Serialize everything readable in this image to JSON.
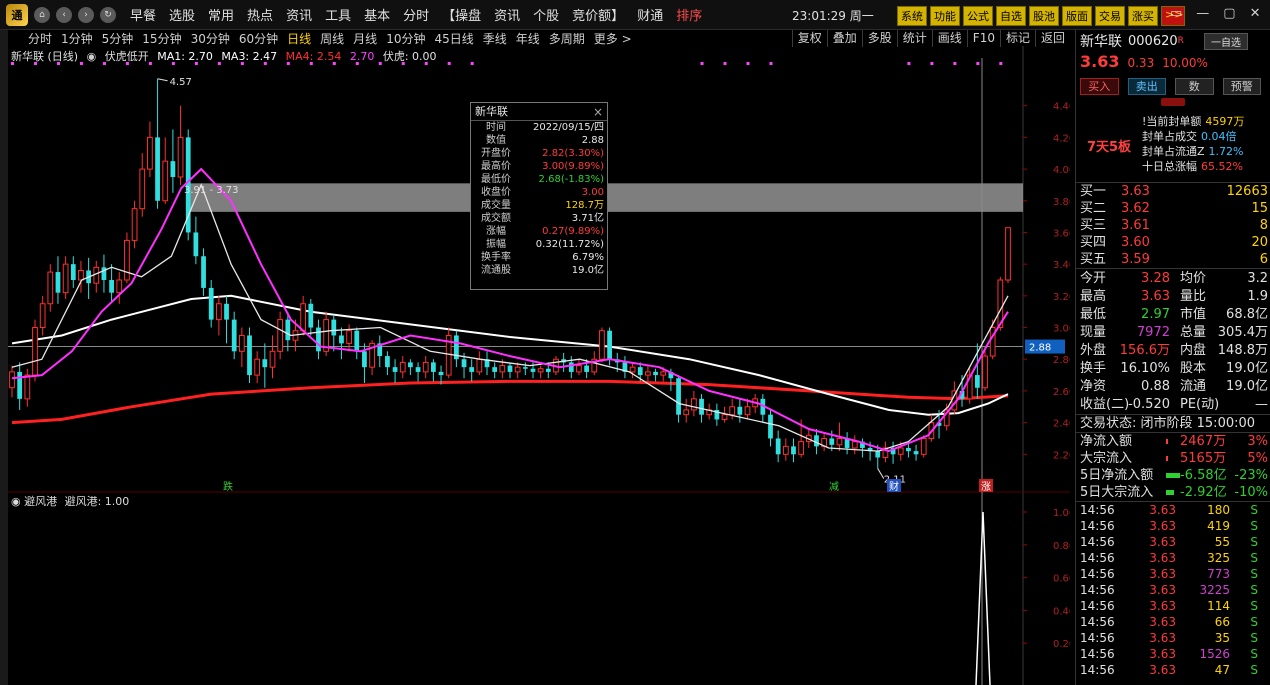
{
  "topbar": {
    "logo": "通",
    "menu": [
      "早餐",
      "选股",
      "常用",
      "热点",
      "资讯",
      "工具",
      "基本",
      "分时",
      "【操盘",
      "资讯",
      "个股",
      "竞价额】",
      "财通",
      "排序"
    ],
    "clock": "23:01:29 周一",
    "tools": [
      "系统",
      "功能",
      "公式",
      "自选",
      "股池",
      "版面",
      "交易",
      "涨买"
    ],
    "double_arrow": ">>",
    "window_controls": [
      "▭",
      "—",
      "▢",
      "✕"
    ]
  },
  "periods": [
    "分时",
    "1分钟",
    "5分钟",
    "15分钟",
    "30分钟",
    "60分钟",
    "日线",
    "周线",
    "月线",
    "10分钟",
    "45日线",
    "季线",
    "年线",
    "多周期",
    "更多 >"
  ],
  "active_period": "日线",
  "right_buttons": [
    "复权",
    "叠加",
    "多股",
    "统计",
    "画线",
    "F10",
    "标记",
    "返回"
  ],
  "legend": {
    "title": "新华联 (日线)",
    "check": "伏虎低开",
    "ma1": "MA1: 2.70",
    "ma3": "MA3: 2.47",
    "ma4": "MA4: 2.54",
    "v270": "2.70",
    "fuhu": "伏虎: 0.00"
  },
  "chart_labels": {
    "high": "4.57",
    "range": "3.91 - 3.73",
    "low": "2.11",
    "crosshair": "2.88",
    "markers": [
      "跌",
      "减",
      "财",
      "涨"
    ]
  },
  "sub_chart": {
    "check": "避风港",
    "value": "避风港: 1.00"
  },
  "chart_data": {
    "type": "candlestick",
    "price_axis": [
      "4.40",
      "4.20",
      "4.00",
      "3.80",
      "3.60",
      "3.40",
      "3.20",
      "3.00",
      "2.80",
      "2.60",
      "2.40",
      "2.20"
    ],
    "sub_axis": [
      "1.00",
      "0.80",
      "0.60",
      "0.40",
      "0.20"
    ],
    "ylim": [
      2.0,
      4.6
    ],
    "crosshair_price": 2.88,
    "shaded_zone": [
      3.73,
      3.91
    ],
    "highest": 4.57,
    "lowest": 2.11,
    "candles": [
      [
        2.62,
        2.72,
        2.56,
        2.76
      ],
      [
        2.72,
        2.55,
        2.48,
        2.78
      ],
      [
        2.55,
        2.7,
        2.5,
        2.74
      ],
      [
        2.7,
        3.0,
        2.66,
        3.05
      ],
      [
        3.0,
        3.15,
        2.95,
        3.2
      ],
      [
        3.15,
        3.35,
        3.1,
        3.4
      ],
      [
        3.35,
        3.22,
        3.15,
        3.45
      ],
      [
        3.22,
        3.4,
        3.18,
        3.45
      ],
      [
        3.4,
        3.3,
        3.25,
        3.45
      ],
      [
        3.3,
        3.36,
        3.22,
        3.42
      ],
      [
        3.36,
        3.28,
        3.18,
        3.44
      ],
      [
        3.28,
        3.38,
        3.22,
        3.42
      ],
      [
        3.38,
        3.3,
        3.22,
        3.46
      ],
      [
        3.3,
        3.22,
        3.16,
        3.4
      ],
      [
        3.22,
        3.3,
        3.15,
        3.35
      ],
      [
        3.3,
        3.55,
        3.28,
        3.6
      ],
      [
        3.55,
        3.75,
        3.5,
        3.8
      ],
      [
        3.75,
        4.0,
        3.7,
        4.1
      ],
      [
        4.0,
        4.2,
        3.95,
        4.3
      ],
      [
        4.2,
        3.8,
        3.75,
        4.57
      ],
      [
        3.8,
        4.05,
        3.78,
        4.2
      ],
      [
        4.05,
        3.95,
        3.85,
        4.25
      ],
      [
        3.95,
        4.2,
        3.9,
        4.4
      ],
      [
        4.2,
        3.6,
        3.55,
        4.25
      ],
      [
        3.6,
        3.45,
        3.4,
        3.7
      ],
      [
        3.45,
        3.25,
        3.2,
        3.5
      ],
      [
        3.25,
        3.05,
        3.0,
        3.3
      ],
      [
        3.05,
        3.15,
        2.95,
        3.2
      ],
      [
        3.15,
        3.05,
        2.9,
        3.2
      ],
      [
        3.05,
        2.85,
        2.8,
        3.1
      ],
      [
        2.85,
        2.95,
        2.75,
        3.0
      ],
      [
        2.95,
        2.7,
        2.65,
        3.0
      ],
      [
        2.7,
        2.8,
        2.65,
        2.85
      ],
      [
        2.8,
        2.75,
        2.62,
        2.9
      ],
      [
        2.75,
        2.85,
        2.68,
        2.95
      ],
      [
        2.85,
        3.05,
        2.8,
        3.1
      ],
      [
        3.05,
        2.92,
        2.85,
        3.1
      ],
      [
        2.92,
        2.98,
        2.85,
        3.05
      ],
      [
        2.98,
        3.15,
        2.95,
        3.2
      ],
      [
        3.15,
        3.0,
        2.95,
        3.18
      ],
      [
        3.0,
        2.85,
        2.8,
        3.05
      ],
      [
        2.85,
        3.05,
        2.82,
        3.1
      ],
      [
        3.05,
        2.95,
        2.85,
        3.08
      ],
      [
        2.95,
        2.9,
        2.8,
        3.0
      ],
      [
        2.9,
        2.98,
        2.85,
        3.02
      ],
      [
        2.98,
        2.85,
        2.8,
        3.0
      ],
      [
        2.85,
        2.75,
        2.65,
        2.9
      ],
      [
        2.75,
        2.9,
        2.7,
        2.92
      ],
      [
        2.9,
        2.82,
        2.75,
        2.95
      ],
      [
        2.82,
        2.75,
        2.7,
        2.85
      ],
      [
        2.75,
        2.72,
        2.65,
        2.8
      ],
      [
        2.72,
        2.78,
        2.68,
        2.82
      ],
      [
        2.78,
        2.75,
        2.7,
        2.8
      ],
      [
        2.75,
        2.72,
        2.66,
        2.78
      ],
      [
        2.72,
        2.78,
        2.68,
        2.82
      ],
      [
        2.78,
        2.72,
        2.66,
        2.8
      ],
      [
        2.72,
        2.7,
        2.64,
        2.76
      ],
      [
        2.7,
        2.95,
        2.68,
        3.0
      ],
      [
        2.95,
        2.8,
        2.75,
        2.98
      ],
      [
        2.8,
        2.75,
        2.68,
        2.84
      ],
      [
        2.75,
        2.72,
        2.66,
        2.8
      ],
      [
        2.72,
        2.8,
        2.7,
        2.85
      ],
      [
        2.8,
        2.75,
        2.7,
        2.85
      ],
      [
        2.75,
        2.72,
        2.68,
        2.78
      ],
      [
        2.72,
        2.76,
        2.68,
        2.8
      ],
      [
        2.76,
        2.72,
        2.68,
        2.78
      ],
      [
        2.72,
        2.75,
        2.68,
        2.78
      ],
      [
        2.75,
        2.74,
        2.7,
        2.78
      ],
      [
        2.74,
        2.72,
        2.68,
        2.78
      ],
      [
        2.72,
        2.74,
        2.68,
        2.76
      ],
      [
        2.74,
        2.72,
        2.68,
        2.78
      ],
      [
        2.72,
        2.8,
        2.7,
        2.82
      ],
      [
        2.8,
        2.78,
        2.72,
        2.84
      ],
      [
        2.78,
        2.72,
        2.68,
        2.82
      ],
      [
        2.72,
        2.76,
        2.7,
        2.8
      ],
      [
        2.76,
        2.72,
        2.68,
        2.8
      ],
      [
        2.72,
        2.8,
        2.7,
        2.85
      ],
      [
        2.8,
        2.98,
        2.78,
        3.0
      ],
      [
        2.98,
        2.8,
        2.76,
        3.0
      ],
      [
        2.8,
        2.78,
        2.72,
        2.84
      ],
      [
        2.78,
        2.72,
        2.68,
        2.82
      ],
      [
        2.72,
        2.75,
        2.68,
        2.78
      ],
      [
        2.75,
        2.7,
        2.66,
        2.78
      ],
      [
        2.7,
        2.72,
        2.66,
        2.76
      ],
      [
        2.72,
        2.7,
        2.66,
        2.74
      ],
      [
        2.7,
        2.72,
        2.66,
        2.75
      ],
      [
        2.72,
        2.68,
        2.6,
        2.74
      ],
      [
        2.68,
        2.45,
        2.4,
        2.7
      ],
      [
        2.45,
        2.48,
        2.4,
        2.55
      ],
      [
        2.48,
        2.55,
        2.44,
        2.6
      ],
      [
        2.55,
        2.45,
        2.4,
        2.58
      ],
      [
        2.45,
        2.48,
        2.42,
        2.52
      ],
      [
        2.48,
        2.42,
        2.38,
        2.52
      ],
      [
        2.42,
        2.45,
        2.4,
        2.5
      ],
      [
        2.45,
        2.5,
        2.42,
        2.55
      ],
      [
        2.5,
        2.45,
        2.4,
        2.55
      ],
      [
        2.45,
        2.5,
        2.42,
        2.55
      ],
      [
        2.5,
        2.55,
        2.46,
        2.58
      ],
      [
        2.55,
        2.45,
        2.4,
        2.58
      ],
      [
        2.45,
        2.3,
        2.25,
        2.48
      ],
      [
        2.3,
        2.2,
        2.15,
        2.35
      ],
      [
        2.2,
        2.25,
        2.16,
        2.3
      ],
      [
        2.25,
        2.2,
        2.15,
        2.3
      ],
      [
        2.2,
        2.28,
        2.18,
        2.42
      ],
      [
        2.28,
        2.32,
        2.24,
        2.36
      ],
      [
        2.32,
        2.25,
        2.2,
        2.36
      ],
      [
        2.25,
        2.3,
        2.22,
        2.34
      ],
      [
        2.3,
        2.26,
        2.22,
        2.35
      ],
      [
        2.26,
        2.3,
        2.22,
        2.4
      ],
      [
        2.3,
        2.24,
        2.2,
        2.34
      ],
      [
        2.24,
        2.28,
        2.2,
        2.32
      ],
      [
        2.28,
        2.24,
        2.18,
        2.3
      ],
      [
        2.24,
        2.22,
        2.16,
        2.28
      ],
      [
        2.22,
        2.18,
        2.11,
        2.26
      ],
      [
        2.18,
        2.24,
        2.15,
        2.28
      ],
      [
        2.24,
        2.2,
        2.14,
        2.28
      ],
      [
        2.2,
        2.24,
        2.16,
        2.28
      ],
      [
        2.24,
        2.22,
        2.18,
        2.28
      ],
      [
        2.22,
        2.2,
        2.16,
        2.26
      ],
      [
        2.2,
        2.3,
        2.18,
        2.32
      ],
      [
        2.3,
        2.4,
        2.28,
        2.45
      ],
      [
        2.4,
        2.38,
        2.3,
        2.48
      ],
      [
        2.38,
        2.48,
        2.35,
        2.52
      ],
      [
        2.48,
        2.6,
        2.45,
        2.66
      ],
      [
        2.6,
        2.55,
        2.5,
        2.7
      ],
      [
        2.55,
        2.7,
        2.52,
        2.75
      ],
      [
        2.7,
        2.62,
        2.55,
        2.9
      ],
      [
        2.62,
        2.82,
        2.6,
        2.88
      ],
      [
        2.82,
        3.0,
        2.8,
        3.05
      ],
      [
        3.0,
        3.3,
        2.98,
        3.32
      ],
      [
        3.3,
        3.63,
        3.28,
        3.63
      ]
    ],
    "ma_white_long": [
      [
        0,
        2.9
      ],
      [
        0.05,
        2.95
      ],
      [
        0.1,
        3.05
      ],
      [
        0.18,
        3.18
      ],
      [
        0.22,
        3.2
      ],
      [
        0.3,
        3.1
      ],
      [
        0.4,
        3.02
      ],
      [
        0.5,
        2.94
      ],
      [
        0.6,
        2.88
      ],
      [
        0.68,
        2.8
      ],
      [
        0.75,
        2.7
      ],
      [
        0.82,
        2.58
      ],
      [
        0.88,
        2.48
      ],
      [
        0.92,
        2.45
      ],
      [
        0.95,
        2.46
      ],
      [
        0.98,
        2.52
      ],
      [
        1.0,
        2.58
      ]
    ],
    "ma_red": [
      [
        0,
        2.4
      ],
      [
        0.05,
        2.42
      ],
      [
        0.12,
        2.5
      ],
      [
        0.2,
        2.58
      ],
      [
        0.3,
        2.62
      ],
      [
        0.4,
        2.65
      ],
      [
        0.5,
        2.66
      ],
      [
        0.6,
        2.66
      ],
      [
        0.7,
        2.64
      ],
      [
        0.8,
        2.6
      ],
      [
        0.9,
        2.56
      ],
      [
        0.95,
        2.55
      ],
      [
        1.0,
        2.57
      ]
    ],
    "ma_magenta": [
      [
        0,
        2.68
      ],
      [
        0.03,
        2.7
      ],
      [
        0.06,
        2.85
      ],
      [
        0.09,
        3.1
      ],
      [
        0.12,
        3.28
      ],
      [
        0.15,
        3.62
      ],
      [
        0.17,
        3.88
      ],
      [
        0.19,
        4.0
      ],
      [
        0.22,
        3.8
      ],
      [
        0.25,
        3.4
      ],
      [
        0.28,
        3.05
      ],
      [
        0.31,
        2.88
      ],
      [
        0.35,
        2.85
      ],
      [
        0.4,
        2.95
      ],
      [
        0.45,
        2.9
      ],
      [
        0.5,
        2.82
      ],
      [
        0.55,
        2.75
      ],
      [
        0.6,
        2.8
      ],
      [
        0.65,
        2.75
      ],
      [
        0.7,
        2.6
      ],
      [
        0.75,
        2.52
      ],
      [
        0.8,
        2.36
      ],
      [
        0.85,
        2.28
      ],
      [
        0.88,
        2.22
      ],
      [
        0.92,
        2.32
      ],
      [
        0.95,
        2.55
      ],
      [
        0.98,
        2.9
      ],
      [
        1.0,
        3.1
      ]
    ],
    "ma_white_short": [
      [
        0,
        2.75
      ],
      [
        0.03,
        2.8
      ],
      [
        0.07,
        3.3
      ],
      [
        0.1,
        3.38
      ],
      [
        0.13,
        3.32
      ],
      [
        0.16,
        3.45
      ],
      [
        0.19,
        3.9
      ],
      [
        0.22,
        3.4
      ],
      [
        0.25,
        3.05
      ],
      [
        0.28,
        2.95
      ],
      [
        0.32,
        2.98
      ],
      [
        0.37,
        3.0
      ],
      [
        0.42,
        2.85
      ],
      [
        0.47,
        2.8
      ],
      [
        0.52,
        2.76
      ],
      [
        0.57,
        2.8
      ],
      [
        0.62,
        2.72
      ],
      [
        0.67,
        2.52
      ],
      [
        0.72,
        2.45
      ],
      [
        0.77,
        2.38
      ],
      [
        0.82,
        2.24
      ],
      [
        0.87,
        2.22
      ],
      [
        0.9,
        2.28
      ],
      [
        0.94,
        2.5
      ],
      [
        0.97,
        2.85
      ],
      [
        1.0,
        3.2
      ]
    ]
  },
  "tooltip": {
    "title": "新华联",
    "close": "×",
    "rows": [
      {
        "k": "时间",
        "v": "2022/09/15/四",
        "c": "#e8e8e8"
      },
      {
        "k": "数值",
        "v": "2.88",
        "c": "#e8e8e8"
      },
      {
        "k": "开盘价",
        "v": "2.82(3.30%)",
        "c": "#ff3b3b"
      },
      {
        "k": "最高价",
        "v": "3.00(9.89%)",
        "c": "#ff3b3b"
      },
      {
        "k": "最低价",
        "v": "2.68(-1.83%)",
        "c": "#30d030"
      },
      {
        "k": "收盘价",
        "v": "3.00",
        "c": "#ff3b3b"
      },
      {
        "k": "成交量",
        "v": "128.7万",
        "c": "#ffd400"
      },
      {
        "k": "成交额",
        "v": "3.71亿",
        "c": "#e8e8e8"
      },
      {
        "k": "涨幅",
        "v": "0.27(9.89%)",
        "c": "#ff3b3b"
      },
      {
        "k": "振幅",
        "v": "0.32(11.72%)",
        "c": "#e8e8e8"
      },
      {
        "k": "换手率",
        "v": "6.79%",
        "c": "#e8e8e8"
      },
      {
        "k": "流通股",
        "v": "19.0亿",
        "c": "#e8e8e8"
      }
    ]
  },
  "right_panel": {
    "name": "新华联",
    "code": "000620",
    "r": "R",
    "self_select": "一自选",
    "price": "3.63",
    "change": "0.33",
    "pct": "10.00%",
    "buttons": {
      "buy": "买入",
      "sell": "卖出",
      "num": "数",
      "alert": "预警"
    },
    "board_label": "7天5板",
    "board": [
      {
        "k": "!当前封单额",
        "v": "4597万",
        "c": "#ffd400"
      },
      {
        "k": "封单占成交",
        "v": "0.04倍",
        "c": "#40c0ff"
      },
      {
        "k": "封单占流通Z",
        "v": "1.72%",
        "c": "#40c0ff"
      },
      {
        "k": "十日总涨幅",
        "v": "65.52%",
        "c": "#ff3b3b"
      }
    ],
    "orderbook": [
      {
        "k": "买一",
        "p": "3.63",
        "q": "12663"
      },
      {
        "k": "买二",
        "p": "3.62",
        "q": "15"
      },
      {
        "k": "买三",
        "p": "3.61",
        "q": "8"
      },
      {
        "k": "买四",
        "p": "3.60",
        "q": "20"
      },
      {
        "k": "买五",
        "p": "3.59",
        "q": "6"
      }
    ],
    "stats": [
      {
        "k1": "今开",
        "v1": "3.28",
        "c1": "#ff3b3b",
        "k2": "均价",
        "v2": "3.2"
      },
      {
        "k1": "最高",
        "v1": "3.63",
        "c1": "#ff3b3b",
        "k2": "量比",
        "v2": "1.9"
      },
      {
        "k1": "最低",
        "v1": "2.97",
        "c1": "#30d030",
        "k2": "市值",
        "v2": "68.8亿"
      },
      {
        "k1": "现量",
        "v1": "7972",
        "c1": "#d040d0",
        "k2": "总量",
        "v2": "305.4万"
      },
      {
        "k1": "外盘",
        "v1": "156.6万",
        "c1": "#ff3b3b",
        "k2": "内盘",
        "v2": "148.8万"
      },
      {
        "k1": "换手",
        "v1": "16.10%",
        "c1": "#e0e0e0",
        "k2": "股本",
        "v2": "19.0亿"
      },
      {
        "k1": "净资",
        "v1": "0.88",
        "c1": "#e0e0e0",
        "k2": "流通",
        "v2": "19.0亿"
      },
      {
        "k1": "收益(二)",
        "v1": "-0.520",
        "c1": "#e0e0e0",
        "k2": "PE(动)",
        "v2": "—"
      }
    ],
    "trade_status": "交易状态: 闭市阶段 15:00:00",
    "flows": [
      {
        "k": "净流入额",
        "v": "2467万",
        "pct": "3%",
        "c": "#ff3b3b",
        "bar": "#ff3b3b",
        "w": 2
      },
      {
        "k": "大宗流入",
        "v": "5165万",
        "pct": "5%",
        "c": "#ff3b3b",
        "bar": "#ff3b3b",
        "w": 2
      },
      {
        "k": "5日净流入额",
        "v": "-6.58亿",
        "pct": "-23%",
        "c": "#30d030",
        "bar": "#30d030",
        "w": 14
      },
      {
        "k": "5日大宗流入",
        "v": "-2.92亿",
        "pct": "-10%",
        "c": "#30d030",
        "bar": "#30d030",
        "w": 8
      }
    ],
    "trades": [
      {
        "t": "14:56",
        "p": "3.63",
        "v": "180",
        "c": "#ffd400"
      },
      {
        "t": "14:56",
        "p": "3.63",
        "v": "419",
        "c": "#ffd400"
      },
      {
        "t": "14:56",
        "p": "3.63",
        "v": "55",
        "c": "#ffd400"
      },
      {
        "t": "14:56",
        "p": "3.63",
        "v": "325",
        "c": "#ffd400"
      },
      {
        "t": "14:56",
        "p": "3.63",
        "v": "773",
        "c": "#d040d0"
      },
      {
        "t": "14:56",
        "p": "3.63",
        "v": "3225",
        "c": "#d040d0"
      },
      {
        "t": "14:56",
        "p": "3.63",
        "v": "114",
        "c": "#ffd400"
      },
      {
        "t": "14:56",
        "p": "3.63",
        "v": "66",
        "c": "#ffd400"
      },
      {
        "t": "14:56",
        "p": "3.63",
        "v": "35",
        "c": "#ffd400"
      },
      {
        "t": "14:56",
        "p": "3.63",
        "v": "1526",
        "c": "#d040d0"
      },
      {
        "t": "14:56",
        "p": "3.63",
        "v": "47",
        "c": "#ffd400"
      }
    ],
    "trade_side": "S"
  }
}
